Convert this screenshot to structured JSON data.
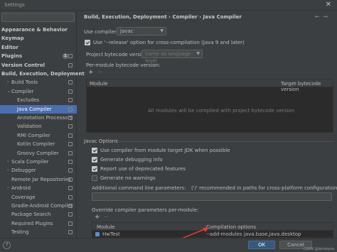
{
  "window": {
    "title": "Settings",
    "close_glyph": "✕"
  },
  "sidebar": {
    "items": [
      {
        "label": "Appearance & Behavior",
        "bold": true,
        "arrow": "›"
      },
      {
        "label": "Keymap",
        "bold": true
      },
      {
        "label": "Editor",
        "bold": true,
        "arrow": "›"
      },
      {
        "label": "Plugins",
        "bold": true,
        "badge": "1"
      },
      {
        "label": "Version Control",
        "bold": true,
        "arrow": "›"
      },
      {
        "label": "Build, Execution, Deployment",
        "bold": true,
        "arrow": "⌄"
      },
      {
        "label": "Build Tools",
        "arrow": "›"
      },
      {
        "label": "Compiler",
        "arrow": "⌄"
      },
      {
        "label": "Excludes"
      },
      {
        "label": "Java Compiler",
        "selected": true
      },
      {
        "label": "Annotation Processors"
      },
      {
        "label": "Validation"
      },
      {
        "label": "RMI Compiler"
      },
      {
        "label": "Kotlin Compiler"
      },
      {
        "label": "Groovy Compiler"
      },
      {
        "label": "Scala Compiler",
        "arrow": "›"
      },
      {
        "label": "Debugger",
        "arrow": "›"
      },
      {
        "label": "Remote Jar Repositories"
      },
      {
        "label": "Android",
        "arrow": "›"
      },
      {
        "label": "Coverage"
      },
      {
        "label": "Gradle-Android Compiler"
      },
      {
        "label": "Package Search"
      },
      {
        "label": "Required Plugins"
      },
      {
        "label": "Testing"
      }
    ]
  },
  "breadcrumb": "Build, Execution, Deployment  ›  Compiler  ›  Java Compiler",
  "breadcrumb_nav": "←→",
  "compiler": {
    "use_compiler_label": "Use compiler:",
    "use_compiler_value": "Javac",
    "release_label": "Use '--release' option for cross-compilation (Java 9 and later)",
    "bytecode_label": "Project bytecode version:",
    "bytecode_value": "Same as language level",
    "per_module_label": "Per-module bytecode version:",
    "add": "+",
    "remove": "−",
    "table_cols": [
      "Module",
      "Target bytecode version"
    ],
    "empty_text": "All modules will be compiled with project bytecode version"
  },
  "javac": {
    "section": "Javac Options",
    "options": [
      {
        "label": "Use compiler from module target JDK when possible",
        "checked": true
      },
      {
        "label": "Generate debugging info",
        "checked": true
      },
      {
        "label": "Report use of deprecated features",
        "checked": true
      },
      {
        "label": "Generate no warnings",
        "checked": false
      }
    ],
    "additional_label": "Additional command line parameters:",
    "additional_hint": "('/' recommended in paths for cross-platform configurations)",
    "override_label": "Override compiler parameters per-module:",
    "override_cols": [
      "Module",
      "Compilation options"
    ],
    "row_module": "HwTest",
    "row_options": "--add-modules java.base,java.desktop"
  },
  "buttons": {
    "ok": "OK",
    "cancel": "Cancel",
    "help": "?"
  },
  "watermark": "CSDN @lenstasia",
  "colors": {
    "selection": "#4b6eaf",
    "annotation_arrow": "#e53935"
  }
}
